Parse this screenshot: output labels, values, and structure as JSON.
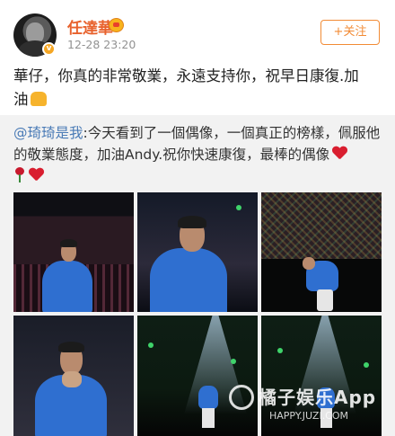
{
  "header": {
    "username": "任達華",
    "timestamp": "12-28 23:20",
    "follow_label": "+关注"
  },
  "post": {
    "text_line1": "華仔，你真的非常敬業，永遠支持你，祝早日康復.加",
    "text_line2": "油"
  },
  "repost": {
    "mention": "@琦琦是我",
    "text_part1": ":今天看到了一個偶像，一個真正的榜樣，佩服",
    "text_part2": "他的敬業態度，加油Andy.祝你快速康復，最棒的偶像",
    "photos_count": 6
  },
  "watermark": {
    "brand": "橘子娱乐App",
    "url": "HAPPY.JUZI.COM"
  },
  "colors": {
    "username": "#e8612c",
    "follow": "#f28b35",
    "mention": "#4a7bb6",
    "repost_bg": "#f2f2f2"
  }
}
